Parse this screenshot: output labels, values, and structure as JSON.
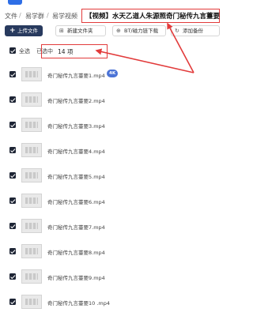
{
  "breadcrumb": {
    "items": [
      "文件",
      "易学群",
      "易学视频"
    ],
    "separator": "/",
    "current": "【视频】水天乙道人朱源照奇门秘传九言薹要"
  },
  "toolbar": {
    "upload_label": "上传文件",
    "new_folder_label": "新建文件夹",
    "bt_download_label": "BT/磁力链下载",
    "add_backup_label": "添加备份"
  },
  "selection": {
    "select_all_label": "全选",
    "selected_prefix": "已选中",
    "count": "14",
    "unit": "项"
  },
  "files": [
    {
      "name": "奇门秘传九言薹要1.mp4",
      "badge": "4K"
    },
    {
      "name": "奇门秘传九言薹要2.mp4"
    },
    {
      "name": "奇门秘传九言薹要3.mp4"
    },
    {
      "name": "奇门秘传九言薹要4.mp4"
    },
    {
      "name": "奇门秘传九言薹要5.mp4"
    },
    {
      "name": "奇门秘传九言薹要6.mp4"
    },
    {
      "name": "奇门秘传九言薹要7.mp4"
    },
    {
      "name": "奇门秘传九言薹要8.mp4"
    },
    {
      "name": "奇门秘传九言薹要9.mp4"
    },
    {
      "name": "奇门秘传九言薹要10 .mp4"
    }
  ],
  "colors": {
    "accent": "#2e6ee6",
    "upload_button": "#283a5e",
    "annotation": "#e23b3b",
    "badge": "#4b73d6"
  }
}
